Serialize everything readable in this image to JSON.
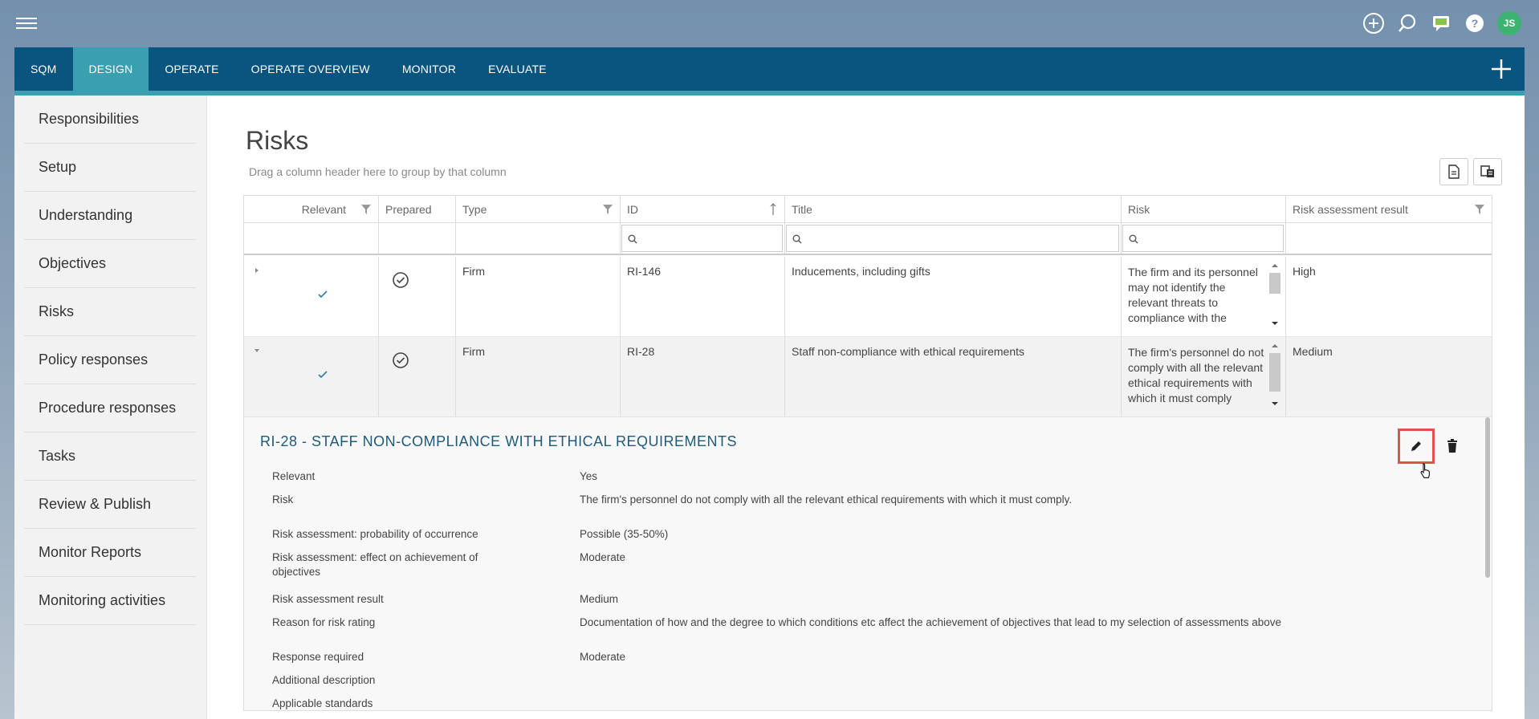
{
  "topbar": {
    "icons": [
      "plus-circle-icon",
      "search-icon",
      "chat-icon",
      "help-icon"
    ],
    "avatar_initials": "JS"
  },
  "nav": {
    "tabs": [
      {
        "label": "SQM",
        "active": false
      },
      {
        "label": "DESIGN",
        "active": true
      },
      {
        "label": "OPERATE",
        "active": false
      },
      {
        "label": "OPERATE OVERVIEW",
        "active": false
      },
      {
        "label": "MONITOR",
        "active": false
      },
      {
        "label": "EVALUATE",
        "active": false
      }
    ]
  },
  "sidebar": {
    "items": [
      {
        "label": "Responsibilities"
      },
      {
        "label": "Setup"
      },
      {
        "label": "Understanding"
      },
      {
        "label": "Objectives"
      },
      {
        "label": "Risks"
      },
      {
        "label": "Policy responses"
      },
      {
        "label": "Procedure responses"
      },
      {
        "label": "Tasks"
      },
      {
        "label": "Review & Publish"
      },
      {
        "label": "Monitor Reports"
      },
      {
        "label": "Monitoring activities"
      }
    ]
  },
  "page": {
    "title": "Risks",
    "group_hint": "Drag a column header here to group by that column"
  },
  "grid": {
    "columns": {
      "relevant": "Relevant",
      "prepared": "Prepared",
      "type": "Type",
      "id": "ID",
      "title": "Title",
      "risk": "Risk",
      "result": "Risk assessment result"
    },
    "rows": [
      {
        "type": "Firm",
        "id": "RI-146",
        "title": "Inducements, including gifts",
        "risk": "The firm and its personnel may not identify the relevant threats to compliance with the conceptual framework",
        "result": "High"
      },
      {
        "type": "Firm",
        "id": "RI-28",
        "title": "Staff non-compliance with ethical requirements",
        "risk": "The firm's personnel do not comply with all the relevant ethical requirements with which it must comply",
        "result": "Medium"
      }
    ]
  },
  "detail": {
    "title": "RI-28 - STAFF NON-COMPLIANCE WITH ETHICAL REQUIREMENTS",
    "fields": [
      {
        "label": "Relevant",
        "value": "Yes"
      },
      {
        "label": "Risk",
        "value": "The firm's personnel do not comply with all the relevant ethical requirements with which it must comply."
      },
      {
        "label": "Risk assessment: probability of occurrence",
        "value": "Possible (35-50%)"
      },
      {
        "label": "Risk assessment: effect on achievement of objectives",
        "value": "Moderate"
      },
      {
        "label": "Risk assessment result",
        "value": "Medium"
      },
      {
        "label": "Reason for risk rating",
        "value": "Documentation of how and the degree to which conditions etc affect the achievement of objectives that lead to my selection of assessments above"
      },
      {
        "label": "Response required",
        "value": "Moderate"
      },
      {
        "label": "Additional description",
        "value": ""
      },
      {
        "label": "Applicable standards",
        "value": ""
      }
    ]
  },
  "colors": {
    "nav_bg": "#09557f",
    "nav_active": "#3a9fb0",
    "avatar": "#3cb371",
    "highlight": "#e0534a"
  }
}
